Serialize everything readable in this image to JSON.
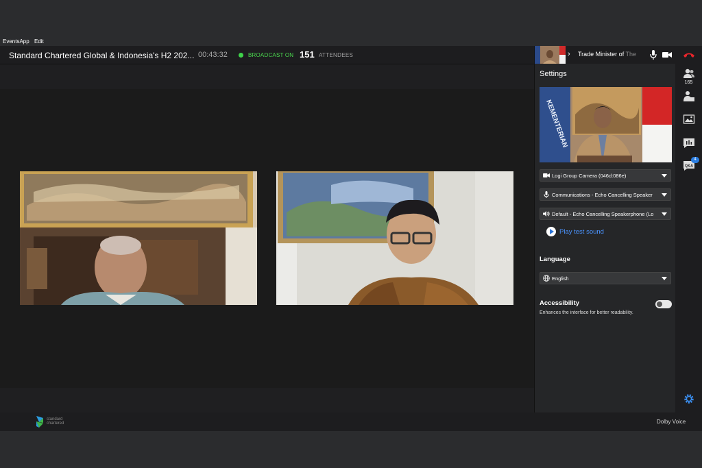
{
  "menubar": {
    "app": "EventsApp",
    "edit": "Edit"
  },
  "header": {
    "title": "Standard Chartered Global & Indonesia's H2 202...",
    "timer": "00:43:32",
    "broadcast": "BROADCAST ON",
    "attendee_count": "151",
    "attendees_label": "ATTENDEES"
  },
  "panel": {
    "speaker_name": "Trade Minister of",
    "speaker_name_dim": " The",
    "settings_title": "Settings",
    "camera": "Logi Group Camera (046d:086e)",
    "microphone": "Communications - Echo Cancelling Speaker",
    "speaker": "Default - Echo Cancelling Speakerphone (Lo",
    "play_test": "Play test sound",
    "language_title": "Language",
    "language_value": "English",
    "accessibility_title": "Accessibility",
    "accessibility_desc": "Enhances the interface for better readability.",
    "accessibility_enabled": false
  },
  "rail": {
    "participants_count": "165",
    "qa_badge": "4",
    "qa_label": "Q&A"
  },
  "footer": {
    "brand_line1": "standard",
    "brand_line2": "chartered",
    "dolby": "Dolby Voice"
  },
  "colors": {
    "live_green": "#3fd34a",
    "hangup_red": "#e6252b",
    "accent_blue": "#2b7de0"
  }
}
